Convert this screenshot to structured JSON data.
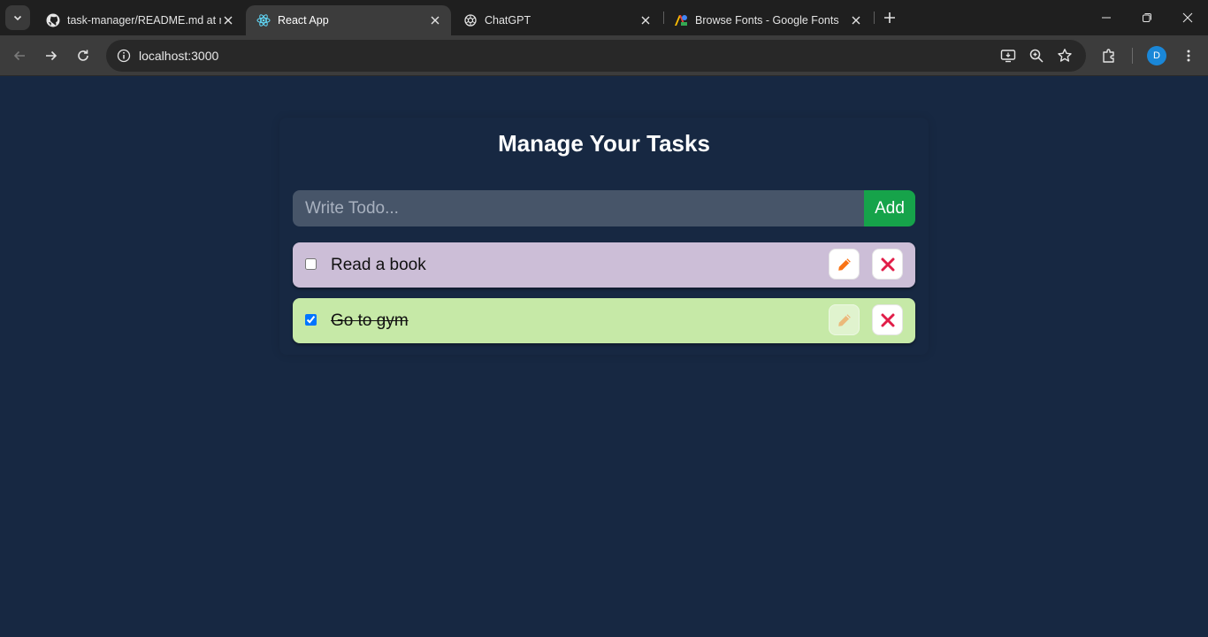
{
  "browser": {
    "tabs": [
      {
        "title": "task-manager/README.md at m",
        "favicon": "github-icon"
      },
      {
        "title": "React App",
        "favicon": "react-icon",
        "active": true
      },
      {
        "title": "ChatGPT",
        "favicon": "chatgpt-icon"
      },
      {
        "title": "Browse Fonts - Google Fonts",
        "favicon": "google-fonts-icon"
      }
    ],
    "url": "localhost:3000",
    "profile_initial": "D"
  },
  "app": {
    "title": "Manage Your Tasks",
    "input_placeholder": "Write Todo...",
    "add_label": "Add",
    "todos": [
      {
        "text": "Read a book",
        "completed": false,
        "color": "#ccbed7"
      },
      {
        "text": "Go to gym",
        "completed": true,
        "color": "#c6e9a7"
      }
    ]
  },
  "colors": {
    "background": "#172842",
    "input_bg": "#475569",
    "add_button": "#16a34a",
    "edit_icon": "#f97316",
    "delete_icon": "#e11d48"
  }
}
